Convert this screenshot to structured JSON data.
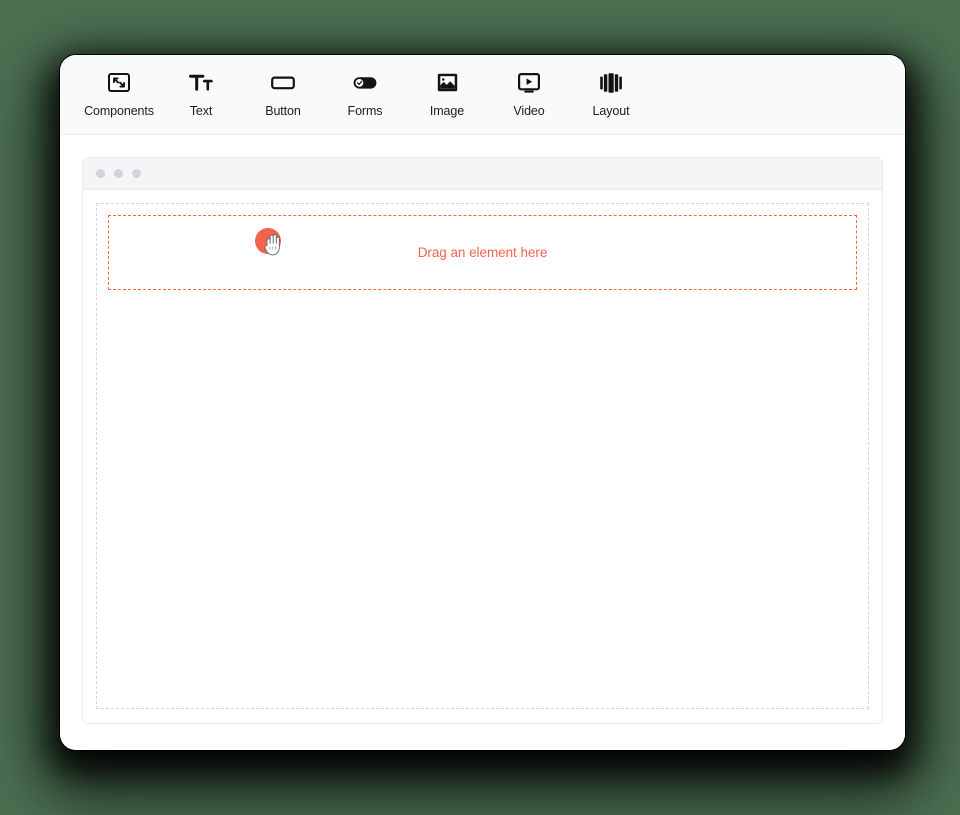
{
  "theme": {
    "background": "#4d7153",
    "window_background": "#ffffff",
    "toolbar_background": "#f9fafa",
    "accent": "#f2654a",
    "border": "#e9ebec",
    "dropzone_border": "#d4d7d9",
    "dot_color": "#d2d5d7",
    "text": "#1b1d1f"
  },
  "toolbar": {
    "items": [
      {
        "label": "Components",
        "icon": "components-icon"
      },
      {
        "label": "Text",
        "icon": "text-icon"
      },
      {
        "label": "Button",
        "icon": "button-icon"
      },
      {
        "label": "Forms",
        "icon": "forms-toggle-icon"
      },
      {
        "label": "Image",
        "icon": "image-icon"
      },
      {
        "label": "Video",
        "icon": "video-icon"
      },
      {
        "label": "Layout",
        "icon": "layout-columns-icon"
      }
    ]
  },
  "canvas": {
    "window_dots": [
      "dot-1",
      "dot-2",
      "dot-3"
    ],
    "dropzone": {
      "label": "Drag an element here"
    },
    "cursor": {
      "icon": "grabbing-hand-cursor",
      "blob_color": "#f2654a"
    }
  }
}
